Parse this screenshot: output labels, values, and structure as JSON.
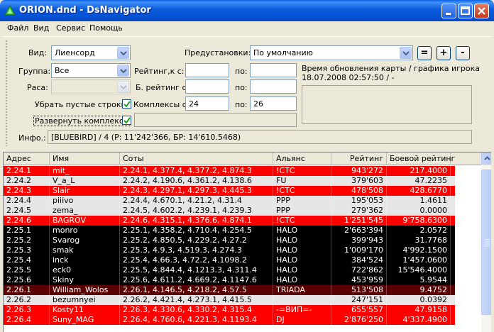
{
  "window": {
    "title": "ORION.dnd - DsNavigator"
  },
  "menu": [
    "Файл",
    "Вид",
    "Сервис",
    "Помощь"
  ],
  "filters": {
    "vid_label": "Вид:",
    "vid_value": "Лиенсорд",
    "gruppa_label": "Группа:",
    "gruppa_value": "Все",
    "rasa_label": "Раса:",
    "rasa_value": "",
    "empty_rows_label": "Убрать пустые строки",
    "expand_label": "Развернуть комплексы",
    "rating_label": "Рейтинг,к с:",
    "battle_rating_label": "Б. рейтинг с:",
    "complexes_label": "Комплексы с:",
    "po_label": "по:",
    "rating_from": "",
    "rating_to": "",
    "battle_from": "",
    "battle_to": "",
    "complexes_from": "24",
    "complexes_to": "26",
    "presets_label": "Предустановки:",
    "presets_value": "По умолчанию",
    "btn_eq": "=",
    "btn_plus": "+",
    "btn_minus": "-",
    "update_time_label": "Время обновления карты / графика игрока",
    "update_time_value": "18.07.2008 02:57:50 / -",
    "info_label": "Инфо.:",
    "info_value": "[BLUEBIRD] / 4 (Р: 11'242'366, БР: 14'610.5468)"
  },
  "table": {
    "columns": [
      "Адрес",
      "Имя",
      "Соты",
      "Альянс",
      "Рейтинг",
      "Боевой рейтинг"
    ],
    "rows": [
      {
        "addr": "2.24.1",
        "name": "mit_",
        "soty": "2.24.1, 4.377.4, 4.377.2, 4.874.3",
        "alliance": "!СТС",
        "rating": "943'272",
        "battle": "217.4000",
        "style": "red"
      },
      {
        "addr": "2.24.2",
        "name": "V_a_L",
        "soty": "2.24.2, 4.190.6, 4.361.2, 4.138.6",
        "alliance": "FU",
        "rating": "379'603",
        "battle": "47.2235",
        "style": "light"
      },
      {
        "addr": "2.24.3",
        "name": "Slair",
        "soty": "2.24.3, 4.297.1, 4.297.3, 4.445.3",
        "alliance": "!СТС",
        "rating": "478'508",
        "battle": "428.6770",
        "style": "red"
      },
      {
        "addr": "2.24.4",
        "name": "piiivo",
        "soty": "2.24.4, 4.670.1, 4.21.2, 4.31.4",
        "alliance": "PPP",
        "rating": "195'053",
        "battle": "1.4611",
        "style": "light"
      },
      {
        "addr": "2.24.5",
        "name": "zema_",
        "soty": "2.24.5, 4.602.2, 4.239.1, 4.239.3",
        "alliance": "PPP",
        "rating": "279'362",
        "battle": "0.0000",
        "style": "light"
      },
      {
        "addr": "2.24.6",
        "name": "BAGROV",
        "soty": "2.24.6, 4.315.1, 4.376.6, 4.874.1",
        "alliance": "!СТС",
        "rating": "1'251'545",
        "battle": "9'758.6300",
        "style": "red"
      },
      {
        "addr": "2.25.1",
        "name": "monro",
        "soty": "2.25.1, 4.358.2, 4.710.4, 4.254.5",
        "alliance": "HALO",
        "rating": "2'663'394",
        "battle": "2.0572",
        "style": "black"
      },
      {
        "addr": "2.25.2",
        "name": "Svarog",
        "soty": "2.25.2, 4.850.5, 4.229.2, 4.27.2",
        "alliance": "HALO",
        "rating": "399'943",
        "battle": "31.7768",
        "style": "black"
      },
      {
        "addr": "2.25.3",
        "name": "smak",
        "soty": "2.25.3, 4.9.3, 4.519.3, 4.274.3",
        "alliance": "HALO",
        "rating": "1'009'170",
        "battle": "4'992.1500",
        "style": "black"
      },
      {
        "addr": "2.25.4",
        "name": "inck",
        "soty": "2.25.4, 4.66.3, 4.72.2, 4.1098.2",
        "alliance": "HALO",
        "rating": "384'524",
        "battle": "1'457.0600",
        "style": "black"
      },
      {
        "addr": "2.25.5",
        "name": "eck0",
        "soty": "2.25.5, 4.844.4, 4.1213.3, 4.311.4",
        "alliance": "HALO",
        "rating": "722'862",
        "battle": "15'546.4000",
        "style": "black"
      },
      {
        "addr": "2.25.6",
        "name": "Skiny",
        "soty": "2.25.6, 4.611.2, 4.669.2, 4.1147.6",
        "alliance": "HALO",
        "rating": "453'959",
        "battle": "5.9544",
        "style": "black"
      },
      {
        "addr": "2.26.1",
        "name": "William_Wolos",
        "soty": "2.26.1, 4.146.5, 4.218.2, 4.57.5",
        "alliance": "TRIADA",
        "rating": "513'508",
        "battle": "9.4752",
        "style": "maroon"
      },
      {
        "addr": "2.26.2",
        "name": "bezumnyei",
        "soty": "2.26.2, 4.421.4, 4.273.1, 4.415.5",
        "alliance": "",
        "rating": "247'151",
        "battle": "0.0392",
        "style": "light"
      },
      {
        "addr": "2.26.3",
        "name": "Kosty11",
        "soty": "2.26.3, 4.330.6, 4.330.2, 4.315.4",
        "alliance": "-=ВИП=-",
        "rating": "655'557",
        "battle": "47.9158",
        "style": "red"
      },
      {
        "addr": "2.26.4",
        "name": "Suny_MAG",
        "soty": "2.26.4, 4.760.6, 4.221.3, 4.1193.4",
        "alliance": "DJ",
        "rating": "2'876'250",
        "battle": "4'337.4900",
        "style": "red"
      }
    ]
  },
  "colors": {
    "red_row": "#ff0000",
    "black_row": "#000000",
    "maroon_row": "#5a0000",
    "light_row": "#e6e6e6"
  }
}
